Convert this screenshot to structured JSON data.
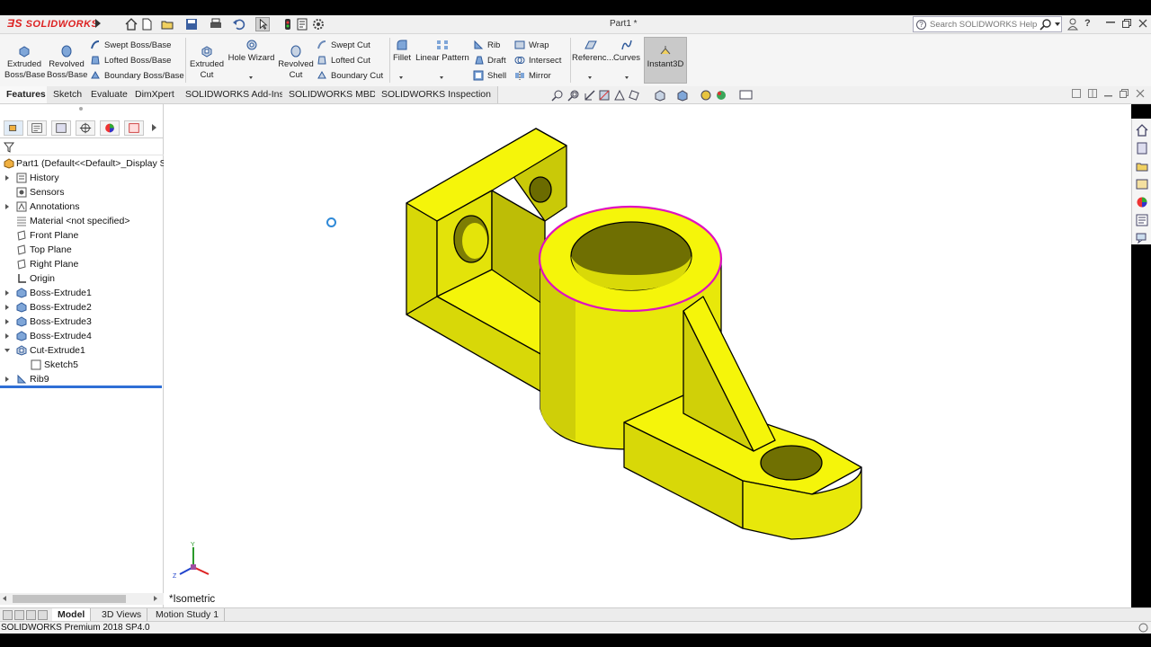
{
  "app": {
    "logo_text": "SOLIDWORKS",
    "window_title": "Part1 *",
    "search_placeholder": "Search SOLIDWORKS Help",
    "help_label": "?"
  },
  "ribbon": {
    "extruded_boss": [
      "Extruded",
      "Boss/Base"
    ],
    "revolved_boss": [
      "Revolved",
      "Boss/Base"
    ],
    "swept_boss": "Swept Boss/Base",
    "lofted_boss": "Lofted Boss/Base",
    "boundary_boss": "Boundary Boss/Base",
    "extruded_cut": [
      "Extruded",
      "Cut"
    ],
    "hole_wizard": "Hole Wizard",
    "revolved_cut": [
      "Revolved",
      "Cut"
    ],
    "swept_cut": "Swept Cut",
    "lofted_cut": "Lofted Cut",
    "boundary_cut": "Boundary Cut",
    "fillet": "Fillet",
    "linear_pattern": "Linear Pattern",
    "rib": "Rib",
    "draft": "Draft",
    "shell": "Shell",
    "wrap": "Wrap",
    "intersect": "Intersect",
    "mirror": "Mirror",
    "reference": "Referenc...",
    "curves": "Curves",
    "instant3d": "Instant3D"
  },
  "command_tabs": [
    "Features",
    "Sketch",
    "Evaluate",
    "DimXpert",
    "SOLIDWORKS Add-Ins",
    "SOLIDWORKS MBD",
    "SOLIDWORKS Inspection"
  ],
  "tree": {
    "root": "Part1  (Default<<Default>_Display S",
    "items": [
      {
        "label": "History"
      },
      {
        "label": "Sensors"
      },
      {
        "label": "Annotations"
      },
      {
        "label": "Material <not specified>"
      },
      {
        "label": "Front Plane"
      },
      {
        "label": "Top Plane"
      },
      {
        "label": "Right Plane"
      },
      {
        "label": "Origin"
      },
      {
        "label": "Boss-Extrude1"
      },
      {
        "label": "Boss-Extrude2"
      },
      {
        "label": "Boss-Extrude3"
      },
      {
        "label": "Boss-Extrude4"
      },
      {
        "label": "Cut-Extrude1"
      },
      {
        "label": "Sketch5"
      },
      {
        "label": "Rib9"
      }
    ]
  },
  "viewport": {
    "view_orientation": "*Isometric",
    "axis_y": "Y",
    "axis_z": "Z",
    "model_color": "#f5f50a",
    "edge_highlight_color": "#e010c0"
  },
  "bottom_tabs": [
    "Model",
    "3D Views",
    "Motion Study 1"
  ],
  "status": {
    "text": "SOLIDWORKS Premium 2018 SP4.0"
  }
}
